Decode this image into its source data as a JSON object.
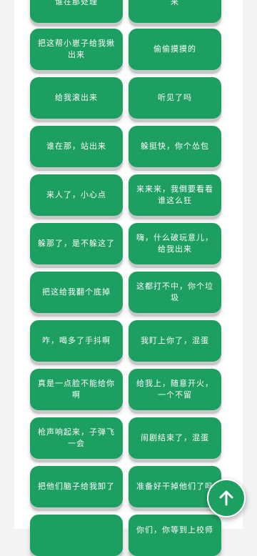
{
  "buttons": [
    "谁在那处理",
    "来",
    "把这帮小崽子给我揪出来",
    "偷偷摸摸的",
    "给我滚出来",
    "听见了吗",
    "谁在那，站出来",
    "躲挺快，你个怂包",
    "来人了，小心点",
    "来来来，我倒要看看谁这么狂",
    "躲那了，是不躲这了",
    "嗨，什么破玩意儿，给我出来",
    "把这给我翻个底掉",
    "这都打不中，你个垃圾",
    "咋，喝多了手抖啊",
    "我盯上你了，混蛋",
    "真是一点脸不能给你啊",
    "给我上，随意开火，一个不留",
    "枪声响起来，子弹飞一会",
    "闹剧结束了，混蛋",
    "把他们脑子给我卸了",
    "准备好干掉他们了吗",
    "",
    "你们，你等到上校师"
  ],
  "fab": {
    "icon": "arrow-up-icon"
  }
}
